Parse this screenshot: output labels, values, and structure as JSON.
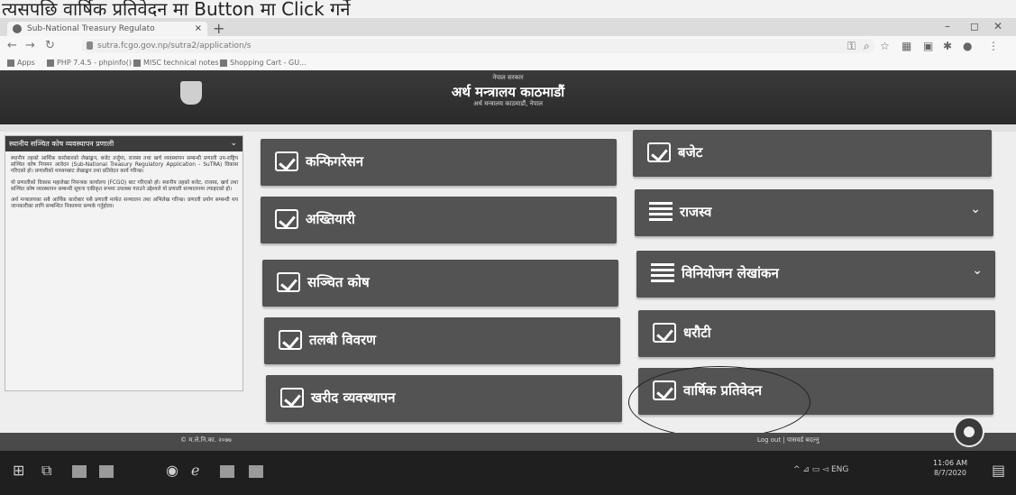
{
  "caption": "त्यसपछि वार्षिक प्रतिवेदन मा Button मा Click गर्ने",
  "browser": {
    "tab_title": "Sub-National Treasury Regulato",
    "tab_close": "×",
    "new_tab": "+",
    "url": "sutra.fcgo.gov.np/sutra2/application/s",
    "bookmarks": [
      "Apps",
      "PHP 7.4.5 - phpinfo()",
      "MISC technical notes",
      "Shopping Cart - GU..."
    ]
  },
  "header": {
    "small": "नेपाल सरकार",
    "title": "अर्थ मन्त्रालय काठमाडौं",
    "subtitle": "अर्थ मन्त्रालय काठमाडौं, नेपाल"
  },
  "sidebar": {
    "title": "स्थानीय सञ्चित कोष व्यवस्थापन प्रणाली",
    "paragraphs": [
      "स्थानीय तहको आर्थिक कारोबारको लेखाङ्कन, बजेट तर्जुमा, राजस्व तथा खर्च व्यवस्थापन सम्बन्धी प्रणाली उप-राष्ट्रिय सञ्चित कोष नियमन आवेदन (Sub-National Treasury Regulatory Application - SuTRA) विकास गरिएको हो। प्रणालीको माध्यमबाट लेखाङ्कन तथा प्रतिवेदन कार्य गरिन्छ।",
      "यो प्रणालीको विकास महालेखा नियन्त्रक कार्यालय (FCGO) बाट गरिएको हो। स्थानीय तहको बजेट, राजस्व, खर्च तथा सञ्चित कोष व्यवस्थापन सम्बन्धी सूचना एकीकृत रूपमा उपलब्ध गराउने उद्देश्यले यो प्रणाली सञ्चालनमा ल्याइएको हो।",
      "अर्थ मन्त्रालयका सबै आर्थिक कारोबार यसै प्रणाली मार्फत सञ्चालन तथा अभिलेख गरिन्छ। प्रणाली प्रयोग सम्बन्धी थप जानकारीका लागि सम्बन्धित निकायमा सम्पर्क गर्नुहोला।"
    ]
  },
  "tiles_left": [
    {
      "label": "कन्फिगरेसन",
      "icon": "checkbox-icon",
      "expand": ""
    },
    {
      "label": "अख्तियारी",
      "icon": "checkbox-icon",
      "expand": ""
    },
    {
      "label": "सञ्चित कोष",
      "icon": "checkbox-icon",
      "expand": ""
    },
    {
      "label": "तलबी विवरण",
      "icon": "checkbox-icon",
      "expand": ""
    },
    {
      "label": "खरीद व्यवस्थापन",
      "icon": "checkbox-icon",
      "expand": ""
    }
  ],
  "tiles_right": [
    {
      "label": "बजेट",
      "icon": "checkbox-icon",
      "expand": ""
    },
    {
      "label": "राजस्व",
      "icon": "list-icon",
      "expand": "⌄"
    },
    {
      "label": "विनियोजन लेखांकन",
      "icon": "list-icon",
      "expand": "⌄"
    },
    {
      "label": "धरौटी",
      "icon": "checkbox-icon",
      "expand": ""
    },
    {
      "label": "वार्षिक प्रतिवेदन",
      "icon": "checkbox-icon",
      "expand": ""
    }
  ],
  "footer": {
    "left": "© म.ले.नि.का. २०७७",
    "right": "Log out | पासवर्ड बदल्नु"
  },
  "taskbar": {
    "tray": "^ ⊿ ▭ ◅ ENG",
    "time": "11:06 AM",
    "date": "8/7/2020"
  }
}
